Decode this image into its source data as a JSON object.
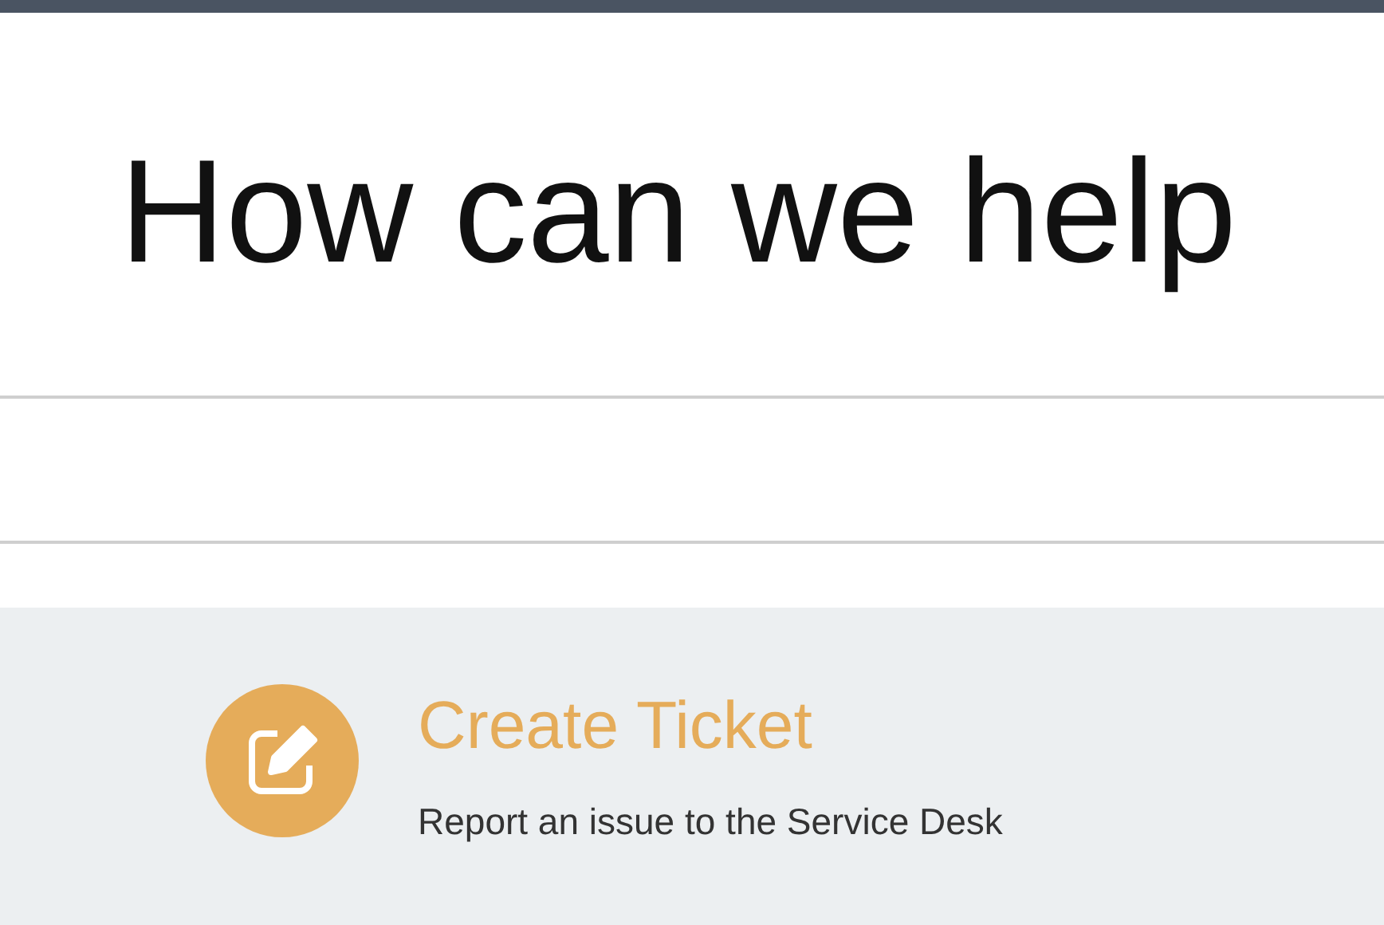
{
  "header": {
    "title": "How can we help"
  },
  "action": {
    "title": "Create Ticket",
    "description": "Report an issue to the Service Desk"
  }
}
